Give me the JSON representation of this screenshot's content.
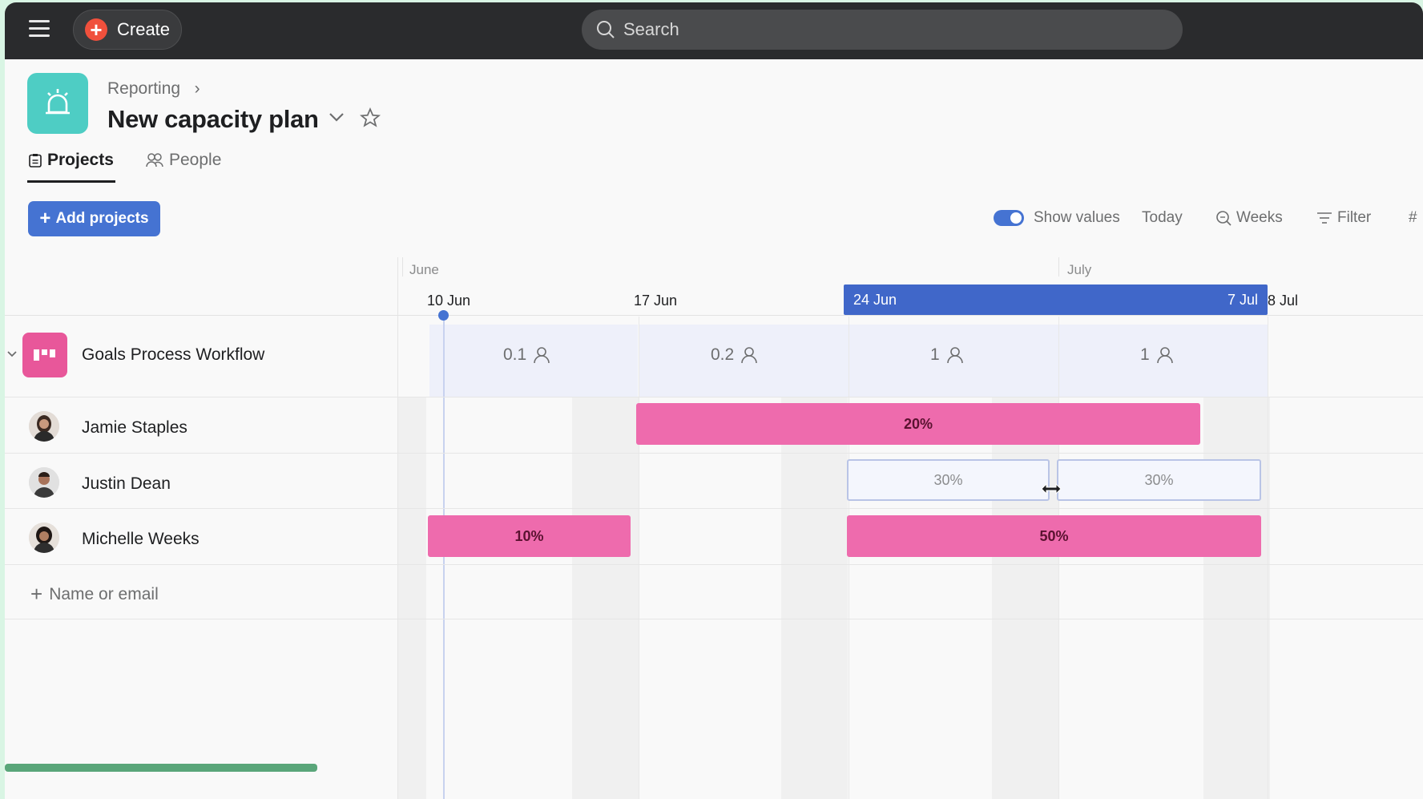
{
  "topbar": {
    "menu_icon": "hamburger-icon",
    "create_label": "Create",
    "search_placeholder": "Search"
  },
  "header": {
    "icon": "alarm-bell-icon",
    "breadcrumb": "Reporting",
    "title": "New capacity plan"
  },
  "tabs": [
    {
      "label": "Projects",
      "icon": "clipboard-icon",
      "active": true
    },
    {
      "label": "People",
      "icon": "people-icon",
      "active": false
    }
  ],
  "toolbar": {
    "add_projects_label": "Add projects",
    "show_values_label": "Show values",
    "show_values_on": true,
    "today_label": "Today",
    "zoom_label": "Weeks",
    "filter_label": "Filter",
    "more_label": "#"
  },
  "timeline": {
    "months": [
      "June",
      "July"
    ],
    "weeks": [
      "10 Jun",
      "17 Jun",
      "24 Jun",
      "7 Jul",
      "8 Jul"
    ],
    "selected_range_start": "24 Jun",
    "selected_range_end": "7 Jul"
  },
  "project": {
    "name": "Goals Process Workflow",
    "weekly_summary": [
      "0.1",
      "0.2",
      "1",
      "1"
    ]
  },
  "people": [
    {
      "name": "Jamie Staples",
      "allocations": [
        {
          "label": "20%",
          "style": "pink"
        }
      ]
    },
    {
      "name": "Justin Dean",
      "allocations": [
        {
          "label": "30%",
          "style": "outline"
        },
        {
          "label": "30%",
          "style": "outline"
        }
      ]
    },
    {
      "name": "Michelle Weeks",
      "allocations": [
        {
          "label": "10%",
          "style": "pink"
        },
        {
          "label": "50%",
          "style": "pink"
        }
      ]
    }
  ],
  "add_person_placeholder": "Name or email",
  "colors": {
    "accent": "#4573d2",
    "allocation_pink": "#ee6bad",
    "header_icon_teal": "#4ecdc4",
    "project_icon_pink": "#e8579a"
  }
}
